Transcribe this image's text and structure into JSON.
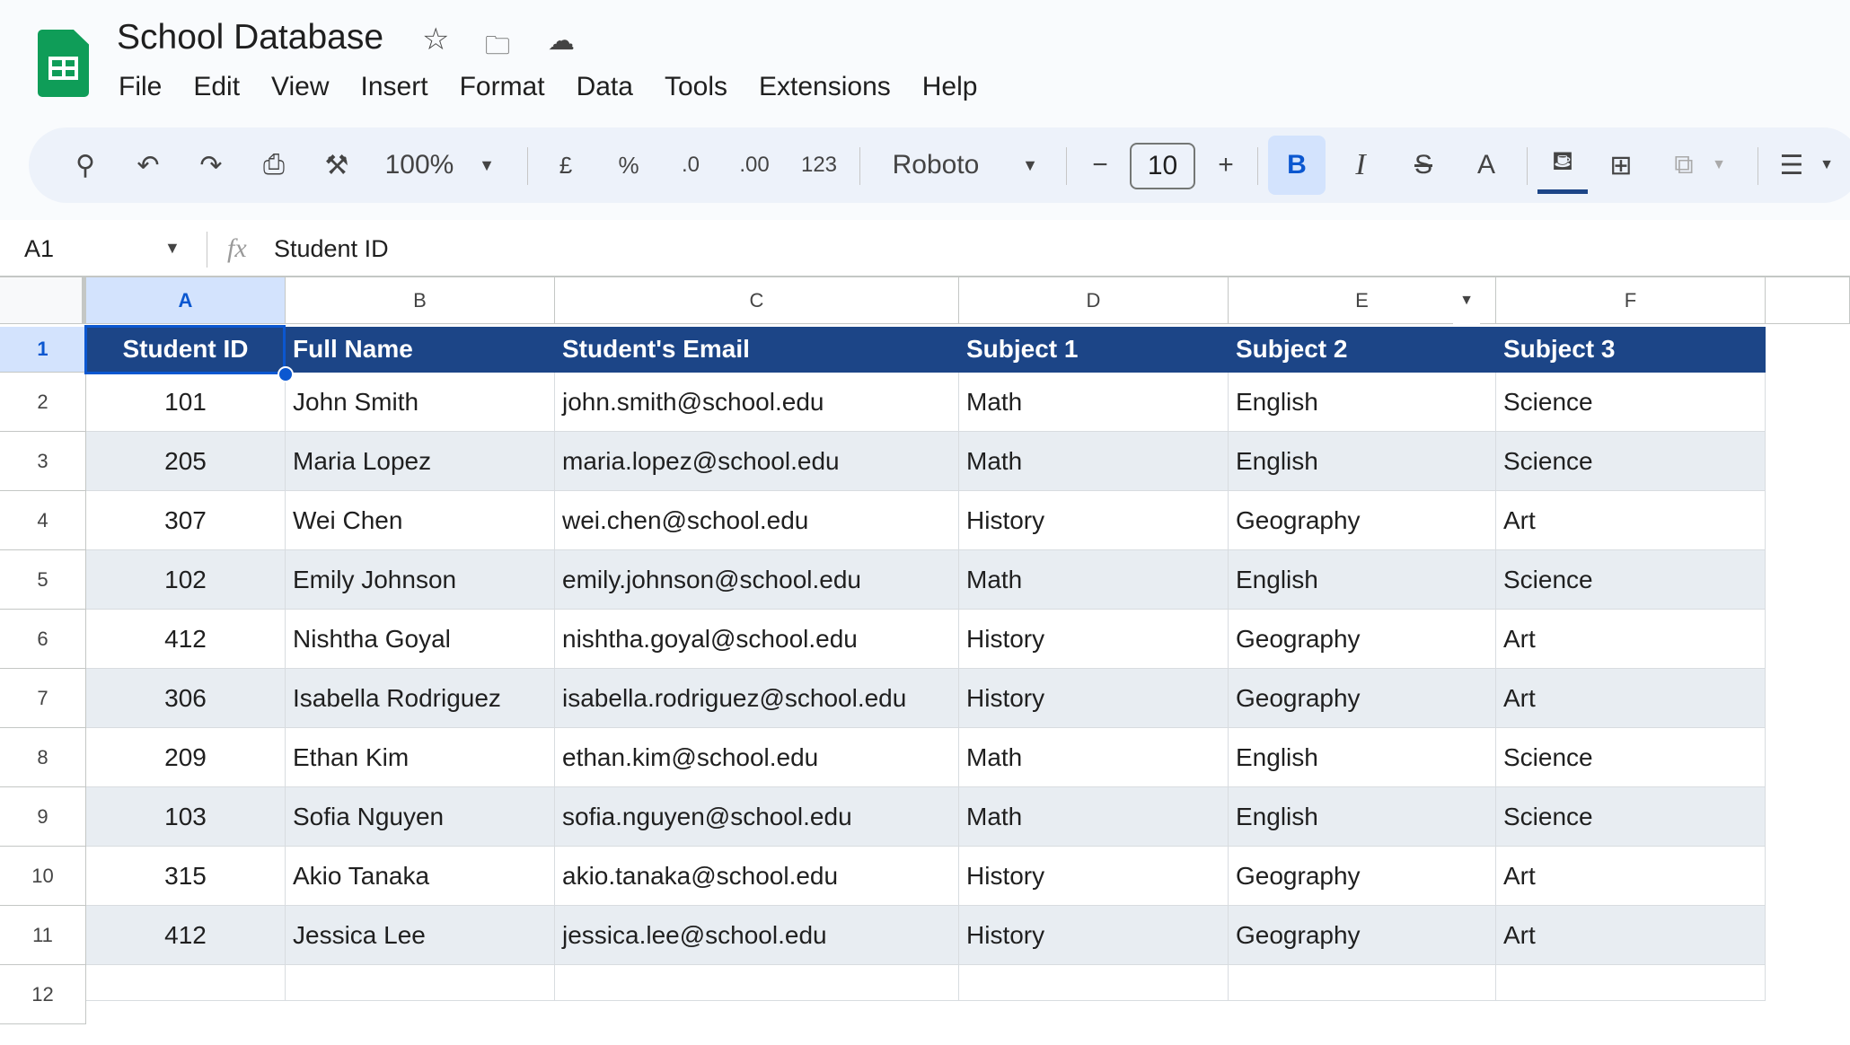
{
  "app": {
    "title": "School Database",
    "menu": [
      "File",
      "Edit",
      "View",
      "Insert",
      "Format",
      "Data",
      "Tools",
      "Extensions",
      "Help"
    ]
  },
  "toolbar": {
    "zoom": "100%",
    "currency": "£",
    "percent": "%",
    "dec_decrease": ".0",
    "dec_increase": ".00",
    "number_format": "123",
    "font": "Roboto",
    "font_size": "10",
    "bold": "B",
    "italic": "I",
    "text_color": "A"
  },
  "formula_bar": {
    "cell_ref": "A1",
    "fx": "fx",
    "value": "Student ID"
  },
  "colors": {
    "header_fill": "#1c4587",
    "alt_row": "#e8edf2",
    "accent": "#0b57d0"
  },
  "columns": [
    "A",
    "B",
    "C",
    "D",
    "E",
    "F"
  ],
  "rows_numbers": [
    "1",
    "2",
    "3",
    "4",
    "5",
    "6",
    "7",
    "8",
    "9",
    "10",
    "11",
    "12"
  ],
  "table": {
    "headers": [
      "Student ID",
      "Full Name",
      "Student's Email",
      "Subject 1",
      "Subject 2",
      "Subject 3"
    ],
    "rows": [
      [
        "101",
        "John Smith",
        "john.smith@school.edu",
        "Math",
        "English",
        "Science"
      ],
      [
        "205",
        "Maria Lopez",
        "maria.lopez@school.edu",
        "Math",
        "English",
        "Science"
      ],
      [
        "307",
        "Wei Chen",
        "wei.chen@school.edu",
        "History",
        "Geography",
        "Art"
      ],
      [
        "102",
        "Emily Johnson",
        "emily.johnson@school.edu",
        "Math",
        "English",
        "Science"
      ],
      [
        "412",
        "Nishtha Goyal",
        "nishtha.goyal@school.edu",
        "History",
        "Geography",
        "Art"
      ],
      [
        "306",
        "Isabella Rodriguez",
        "isabella.rodriguez@school.edu",
        "History",
        "Geography",
        "Art"
      ],
      [
        "209",
        "Ethan Kim",
        "ethan.kim@school.edu",
        "Math",
        "English",
        "Science"
      ],
      [
        "103",
        "Sofia Nguyen",
        "sofia.nguyen@school.edu",
        "Math",
        "English",
        "Science"
      ],
      [
        "315",
        "Akio Tanaka",
        "akio.tanaka@school.edu",
        "History",
        "Geography",
        "Art"
      ],
      [
        "412",
        "Jessica Lee",
        "jessica.lee@school.edu",
        "History",
        "Geography",
        "Art"
      ]
    ]
  }
}
